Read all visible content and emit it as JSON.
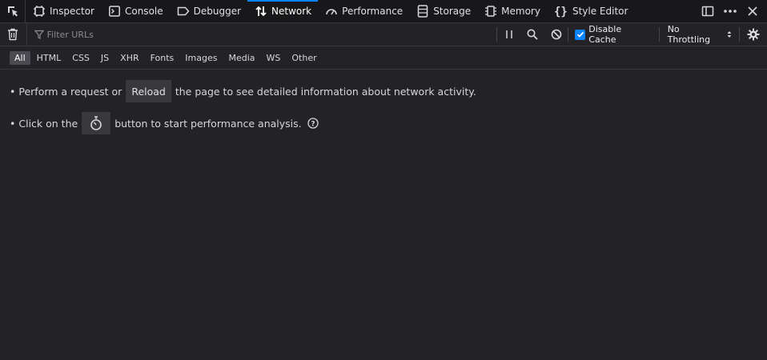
{
  "toolbox": {
    "tabs": [
      {
        "label": "Inspector",
        "icon": "inspector-icon"
      },
      {
        "label": "Console",
        "icon": "console-icon"
      },
      {
        "label": "Debugger",
        "icon": "debugger-icon"
      },
      {
        "label": "Network",
        "icon": "network-icon",
        "active": true
      },
      {
        "label": "Performance",
        "icon": "performance-icon"
      },
      {
        "label": "Storage",
        "icon": "storage-icon"
      },
      {
        "label": "Memory",
        "icon": "memory-icon"
      },
      {
        "label": "Style Editor",
        "icon": "style-editor-icon"
      }
    ]
  },
  "filterbar": {
    "filter_placeholder": "Filter URLs",
    "disable_cache_label": "Disable Cache",
    "disable_cache_checked": true,
    "throttling_label": "No Throttling"
  },
  "type_filters": [
    "All",
    "HTML",
    "CSS",
    "JS",
    "XHR",
    "Fonts",
    "Images",
    "Media",
    "WS",
    "Other"
  ],
  "notice": {
    "reload_prefix": "Perform a request or",
    "reload_button": "Reload",
    "reload_suffix": "the page to see detailed information about network activity.",
    "perf_prefix": "Click on the",
    "perf_suffix": "button to start performance analysis."
  },
  "colors": {
    "accent": "#0a84ff",
    "background": "#232327",
    "toolbar": "#18181a"
  }
}
